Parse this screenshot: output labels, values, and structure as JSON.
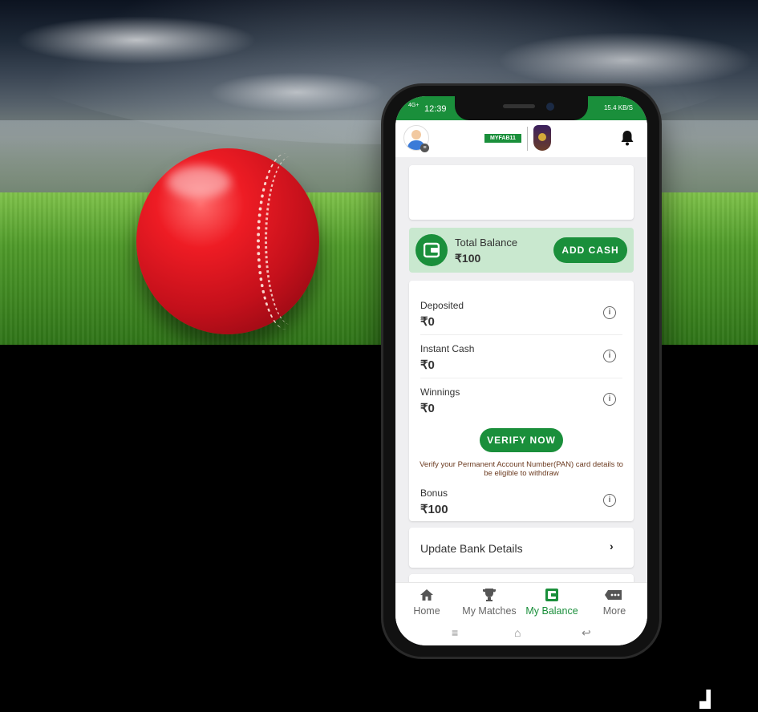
{
  "status_bar": {
    "network": "4G+",
    "time": "12:39",
    "right_info": "15.4 KB/S"
  },
  "header": {
    "brand": "MYFAB11",
    "profile_icon": "avatar-icon",
    "notification_icon": "bell-icon"
  },
  "balance": {
    "label": "Total Balance",
    "amount": "₹100",
    "add_cash": "ADD CASH"
  },
  "breakdown": [
    {
      "label": "Deposited",
      "amount": "₹0",
      "info": "i"
    },
    {
      "label": "Instant Cash",
      "amount": "₹0",
      "info": "i"
    },
    {
      "label": "Winnings",
      "amount": "₹0",
      "info": "i"
    },
    {
      "label": "Bonus",
      "amount": "₹100",
      "info": "i"
    }
  ],
  "verify": {
    "button": "VERIFY NOW",
    "note": "Verify your Permanent Account Number(PAN) card details to be eligible to withdraw"
  },
  "bank": {
    "label": "Update Bank Details",
    "chevron": "›"
  },
  "tabs": [
    {
      "label": "Home",
      "icon": "home-icon"
    },
    {
      "label": "My Matches",
      "icon": "trophy-icon"
    },
    {
      "label": "My Balance",
      "icon": "wallet-icon",
      "active": true
    },
    {
      "label": "More",
      "icon": "more-icon"
    }
  ],
  "nav": {
    "menu": "≡",
    "home": "⌂",
    "back": "↩"
  },
  "colors": {
    "primary": "#1a8f3b",
    "balance_bg": "#c9e8cf",
    "note": "#6b3a1f"
  }
}
